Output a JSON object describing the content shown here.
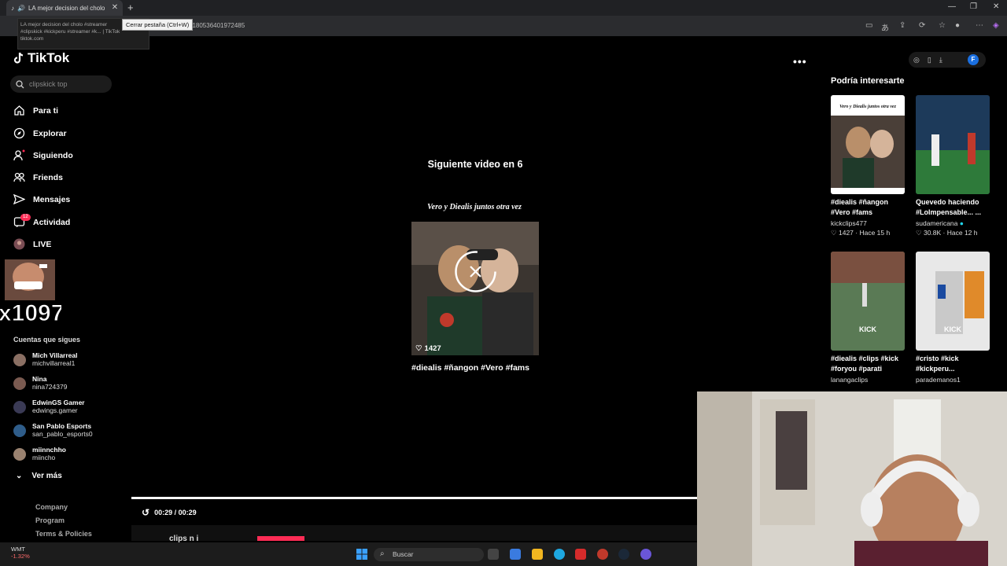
{
  "browser": {
    "tab_title": "LA mejor decision del cholo",
    "tooltip": "Cerrar pestaña (Ctrl+W)",
    "tab_preview_line1": "LA mejor decision del cholo  #streamer",
    "tab_preview_line2": "#clipskick #kickperu #streamer #k... | TikTok",
    "tab_preview_domain": "tiktok.com",
    "url_fragment": "8180536401972485"
  },
  "sidebar": {
    "logo": "TikTok",
    "search_placeholder": "clipskick top",
    "nav": [
      "Para ti",
      "Explorar",
      "Siguiendo",
      "Friends",
      "Mensajes",
      "Actividad",
      "LIVE"
    ],
    "activity_badge": "12",
    "following_title": "Cuentas que sigues",
    "accounts": [
      {
        "name": "Mich Villarreal",
        "user": "michvillarreal1"
      },
      {
        "name": "Nina",
        "user": "nina724379"
      },
      {
        "name": "EdwinGS Gamer",
        "user": "edwings.gamer"
      },
      {
        "name": "San Pablo Esports",
        "user": "san_pablo_esports0"
      },
      {
        "name": "miinnchho",
        "user": "miincho"
      }
    ],
    "ver_mas": "Ver más",
    "footer": [
      "Company",
      "Program",
      "Terms & Policies"
    ]
  },
  "center": {
    "next_label": "Siguiente video en 6",
    "thumb_overlay_text": "Vero y Diealis juntos otra vez",
    "thumb_likes": "1427",
    "description": "#diealis #ñangon #Vero #fams",
    "time": "00:29 / 00:29",
    "bottom_name": "clips n i"
  },
  "right": {
    "title": "Podría interesarte",
    "avatar_letter": "F",
    "cards": [
      {
        "caption": "#diealis #ñangon #Vero #fams",
        "user": "kickclips477",
        "meta": "1427 · Hace 15 h",
        "thumb_text": "Vero y Diealis juntos otra vez"
      },
      {
        "caption": "Quevedo haciendo #LoImpensable... ...",
        "user": "sudamericana",
        "meta": "30.8K · Hace 12 h",
        "thumb_text": ""
      },
      {
        "caption": "#diealis #clips #kick #foryou #parati",
        "user": "lanangaclips",
        "meta": "",
        "thumb_text": "KICK"
      },
      {
        "caption": "#cristo #kick #kickperu...",
        "user": "parademanos1",
        "meta": "",
        "thumb_text": "KICK"
      }
    ]
  },
  "taskbar": {
    "weather_name": "WMT",
    "weather_value": "-1.32%",
    "search": "Buscar"
  },
  "sticker_text": "x1097",
  "colors": {
    "accent": "#fe2c55",
    "bg": "#000000",
    "verified": "#20d5ec"
  }
}
